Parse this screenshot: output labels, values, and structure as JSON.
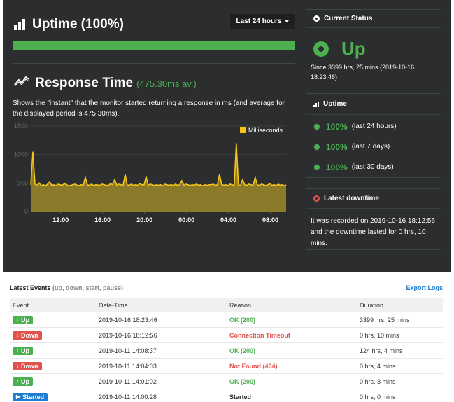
{
  "uptime": {
    "title": "Uptime (100%)",
    "period_button": "Last 24 hours",
    "bar_percent": 100
  },
  "response_time": {
    "title": "Response Time",
    "average": "(475.30ms av.)",
    "description": "Shows the \"instant\" that the monitor started returning a response in ms (and average for the displayed period is 475.30ms)."
  },
  "chart_data": {
    "type": "area",
    "legend": "Milliseconds",
    "y_ticks": [
      "1500",
      "1000",
      "500",
      "0"
    ],
    "ylim": [
      0,
      1500
    ],
    "x_ticks": [
      "12:00",
      "16:00",
      "20:00",
      "00:00",
      "04:00",
      "08:00"
    ],
    "x_tick_hours": [
      12,
      16,
      20,
      24,
      28,
      32
    ],
    "x_range_hours": [
      9.15,
      33.5
    ],
    "grid": true,
    "colors": {
      "line": "#f5c518",
      "fill": "#8a7a2a"
    },
    "series": [
      {
        "name": "Milliseconds",
        "x": [
          9.15,
          9.35,
          9.55,
          9.75,
          9.95,
          10.15,
          10.35,
          10.55,
          10.75,
          10.95,
          11.15,
          11.35,
          11.55,
          11.75,
          11.95,
          12.15,
          12.35,
          12.55,
          12.75,
          12.95,
          13.15,
          13.35,
          13.55,
          13.75,
          13.95,
          14.15,
          14.35,
          14.55,
          14.75,
          14.95,
          15.15,
          15.35,
          15.55,
          15.75,
          15.95,
          16.15,
          16.35,
          16.55,
          16.75,
          16.95,
          17.15,
          17.35,
          17.55,
          17.75,
          17.95,
          18.15,
          18.35,
          18.55,
          18.75,
          18.95,
          19.15,
          19.35,
          19.55,
          19.75,
          19.95,
          20.15,
          20.35,
          20.55,
          20.75,
          20.95,
          21.15,
          21.35,
          21.55,
          21.75,
          21.95,
          22.15,
          22.35,
          22.55,
          22.75,
          22.95,
          23.15,
          23.35,
          23.55,
          23.75,
          23.95,
          24.15,
          24.35,
          24.55,
          24.75,
          24.95,
          25.15,
          25.35,
          25.55,
          25.75,
          25.95,
          26.15,
          26.35,
          26.55,
          26.75,
          26.95,
          27.15,
          27.35,
          27.55,
          27.75,
          27.95,
          28.15,
          28.35,
          28.55,
          28.75,
          28.95,
          29.15,
          29.35,
          29.55,
          29.75,
          29.95,
          30.15,
          30.35,
          30.55,
          30.75,
          30.95,
          31.15,
          31.35,
          31.55,
          31.75,
          31.95,
          32.15,
          32.35,
          32.55,
          32.75,
          32.95,
          33.15,
          33.35,
          33.5
        ],
        "values": [
          470,
          1050,
          480,
          460,
          500,
          455,
          470,
          450,
          480,
          520,
          460,
          470,
          455,
          480,
          470,
          460,
          490,
          475,
          450,
          460,
          470,
          480,
          465,
          455,
          470,
          460,
          600,
          470,
          460,
          480,
          455,
          470,
          465,
          460,
          480,
          470,
          460,
          455,
          490,
          470,
          560,
          460,
          480,
          470,
          460,
          650,
          470,
          460,
          480,
          455,
          470,
          460,
          490,
          470,
          470,
          610,
          460,
          480,
          470,
          455,
          470,
          460,
          470,
          450,
          480,
          470,
          460,
          470,
          455,
          480,
          460,
          470,
          540,
          460,
          480,
          470,
          455,
          470,
          460,
          480,
          460,
          470,
          450,
          470,
          460,
          470,
          470,
          480,
          460,
          470,
          650,
          480,
          460,
          470,
          455,
          480,
          470,
          460,
          1200,
          470,
          455,
          560,
          470,
          460,
          480,
          470,
          455,
          600,
          470,
          460,
          480,
          470,
          455,
          470,
          490,
          460,
          470,
          455,
          480,
          460,
          470,
          450,
          470
        ]
      }
    ]
  },
  "current_status": {
    "title": "Current Status",
    "state": "Up",
    "since": "Since 3399 hrs, 25 mins (2019-10-16 18:23:46)"
  },
  "uptime_card": {
    "title": "Uptime",
    "rows": [
      {
        "pct": "100%",
        "label": "(last 24 hours)"
      },
      {
        "pct": "100%",
        "label": "(last 7 days)"
      },
      {
        "pct": "100%",
        "label": "(last 30 days)"
      }
    ]
  },
  "latest_downtime": {
    "title": "Latest downtime",
    "text": "It was recorded on 2019-10-16 18:12:56 and the downtime lasted for 0 hrs, 10 mins."
  },
  "events": {
    "title": "Latest Events",
    "subtitle": "(up, down, start, pause)",
    "export_label": "Export Logs",
    "columns": [
      "Event",
      "Date-Time",
      "Reason",
      "Duration"
    ],
    "rows": [
      {
        "event": "Up",
        "type": "up",
        "datetime": "2019-10-16 18:23:46",
        "reason": "OK (200)",
        "reason_type": "ok",
        "duration": "3399 hrs, 25 mins"
      },
      {
        "event": "Down",
        "type": "down",
        "datetime": "2019-10-16 18:12:56",
        "reason": "Connection Timeout",
        "reason_type": "bad",
        "duration": "0 hrs, 10 mins"
      },
      {
        "event": "Up",
        "type": "up",
        "datetime": "2019-10-11 14:08:37",
        "reason": "OK (200)",
        "reason_type": "ok",
        "duration": "124 hrs, 4 mins"
      },
      {
        "event": "Down",
        "type": "down",
        "datetime": "2019-10-11 14:04:03",
        "reason": "Not Found (404)",
        "reason_type": "bad",
        "duration": "0 hrs, 4 mins"
      },
      {
        "event": "Up",
        "type": "up",
        "datetime": "2019-10-11 14:01:02",
        "reason": "OK (200)",
        "reason_type": "ok",
        "duration": "0 hrs, 3 mins"
      },
      {
        "event": "Started",
        "type": "started",
        "datetime": "2019-10-11 14:00:28",
        "reason": "Started",
        "reason_type": "plain",
        "duration": "0 hrs, 0 mins"
      }
    ]
  },
  "colors": {
    "green": "#4caf50",
    "red": "#e0524c",
    "blue": "#1e7bd1",
    "dark_bg": "#2b2d2e"
  }
}
